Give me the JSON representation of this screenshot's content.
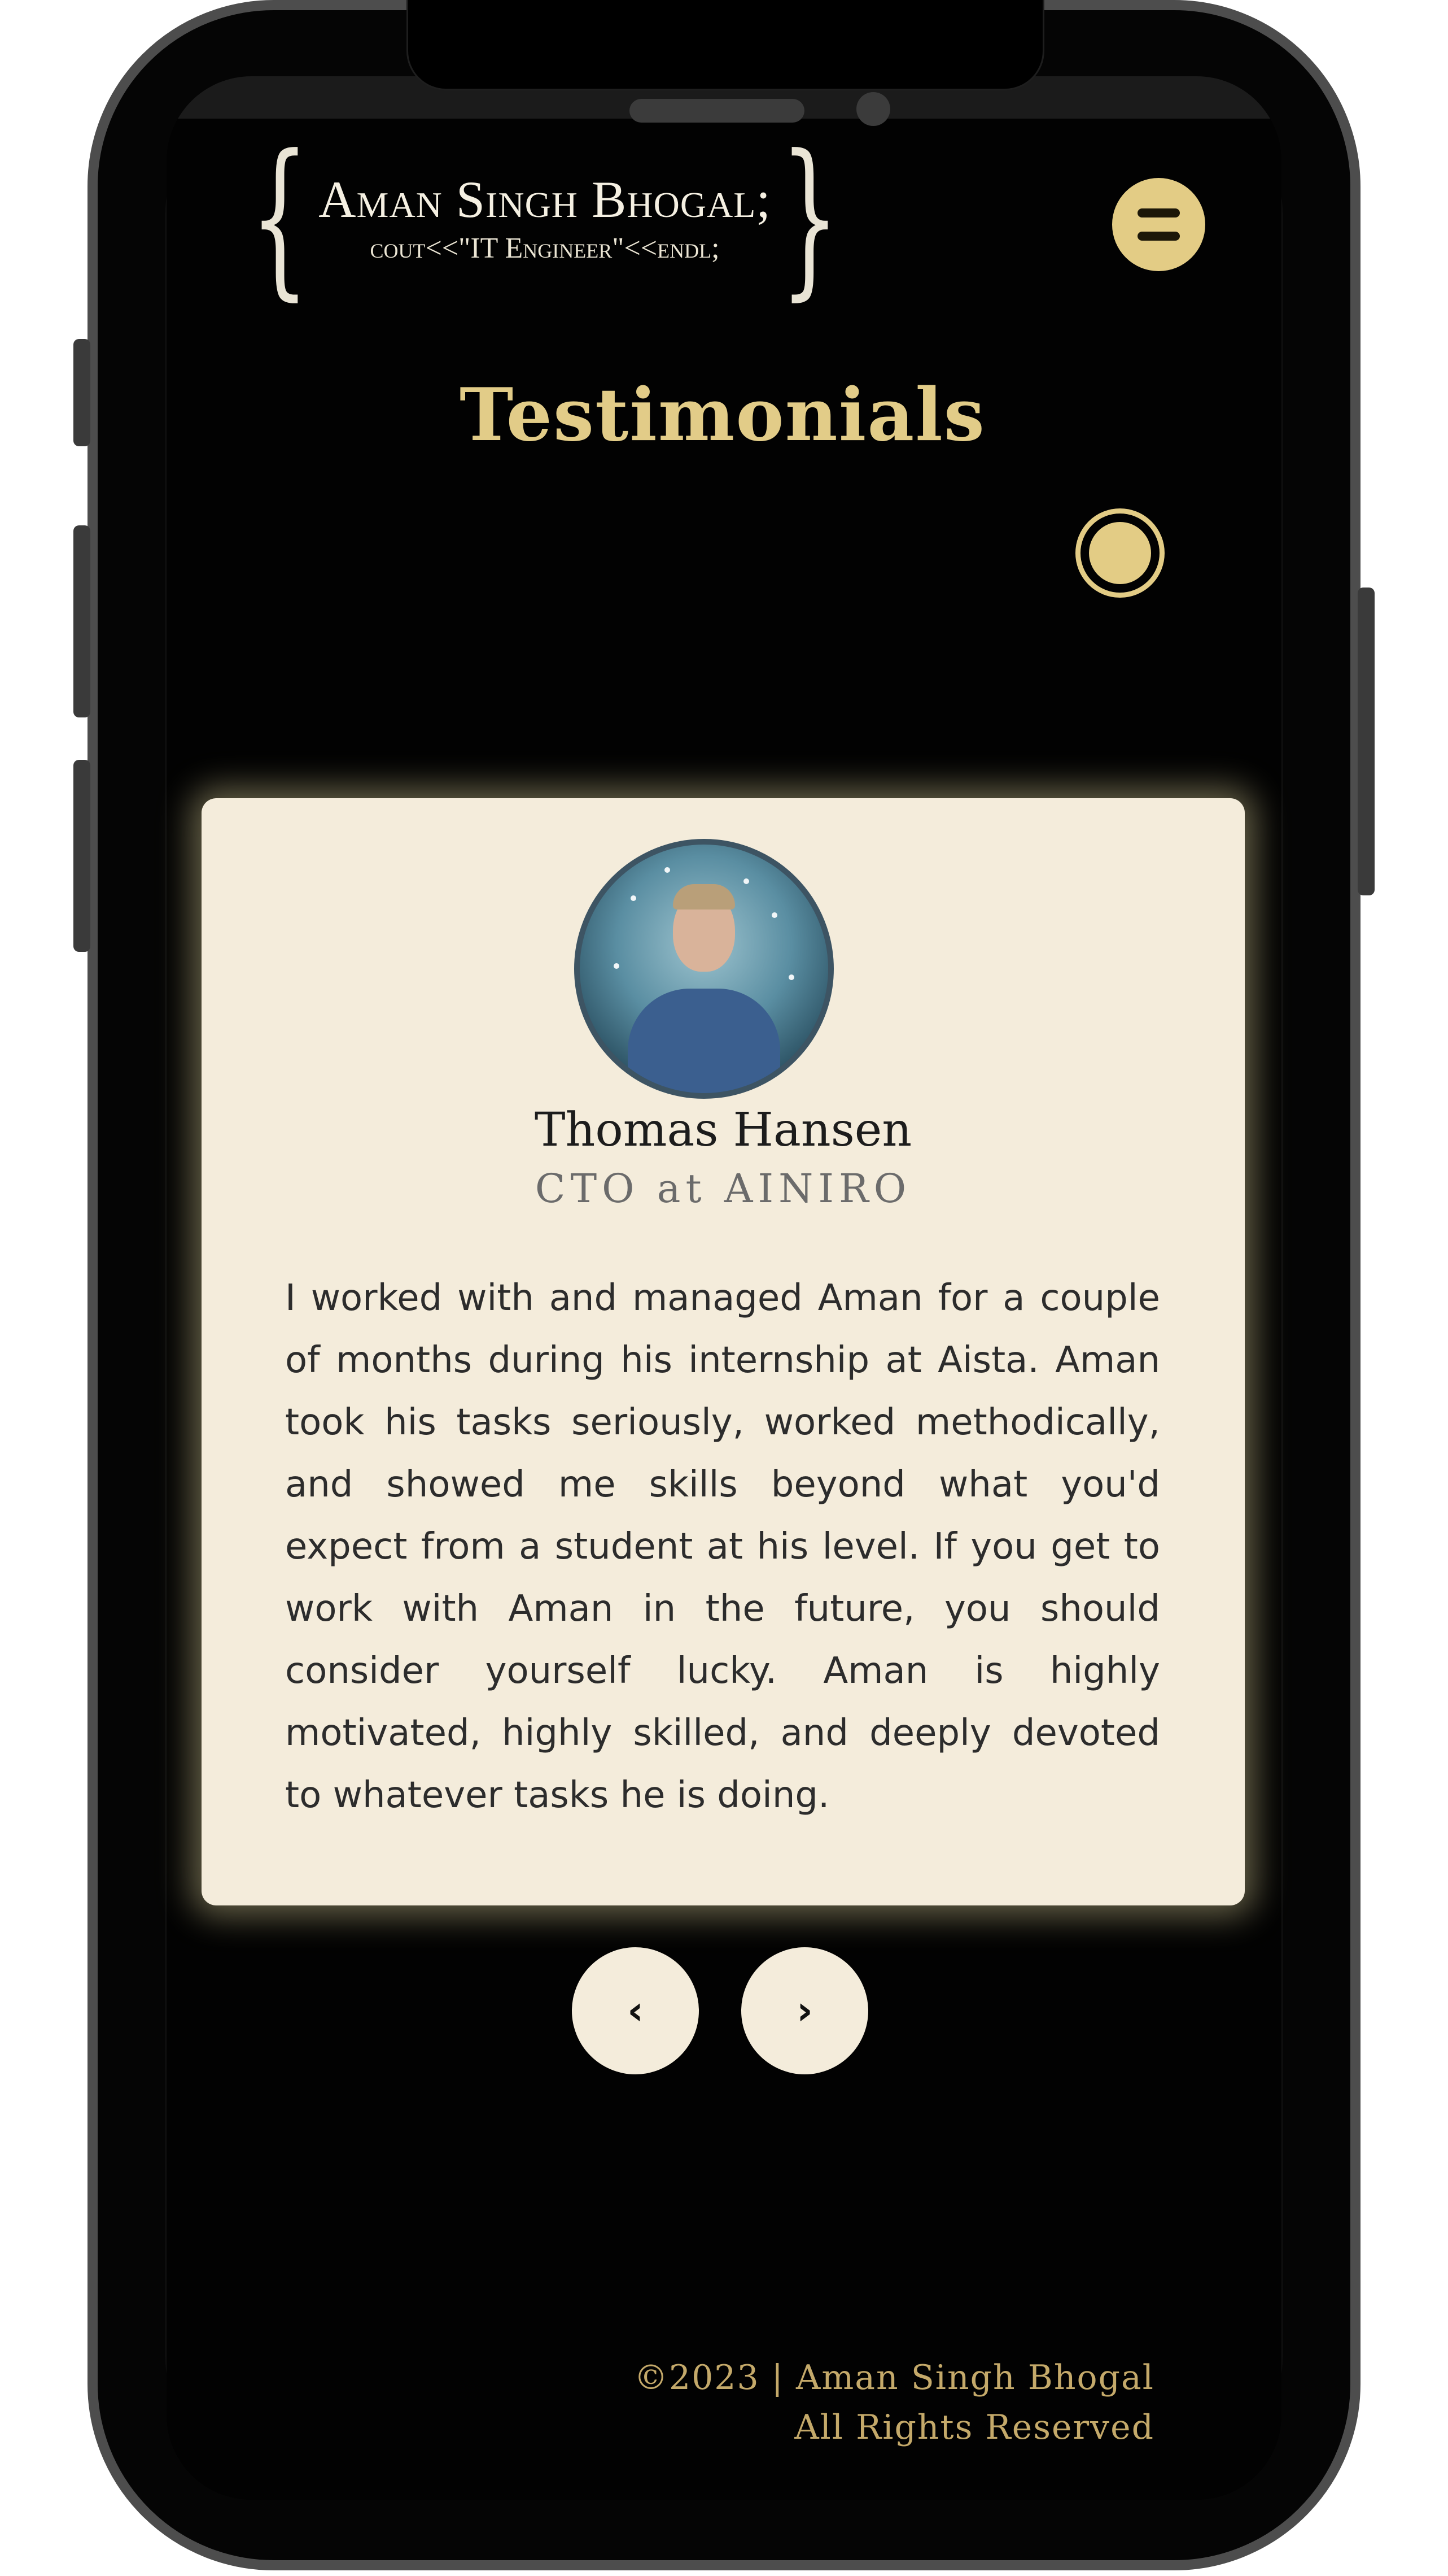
{
  "header": {
    "logo_name": "Aman Singh Bhogal;",
    "logo_subtitle": "cout<<\"IT Engineer\"<<endl;",
    "logo_brace_left": "{",
    "logo_brace_right": "}",
    "menu_icon": "hamburger-menu-icon"
  },
  "page": {
    "title": "Testimonials",
    "theme_toggle_icon": "theme-toggle-icon"
  },
  "testimonial": {
    "name": "Thomas Hansen",
    "role": "CTO at AINIRO",
    "text": "I worked with and managed Aman for a couple of months during his internship at Aista. Aman took his tasks seriously, worked methodically, and showed me skills beyond what you'd expect from a student at his level. If you get to work with Aman in the future, you should consider yourself lucky. Aman is highly motivated, highly skilled, and deeply devoted to whatever tasks he is doing."
  },
  "carousel": {
    "prev_label": "‹",
    "next_label": "›"
  },
  "footer": {
    "line1": "©2023 | Aman Singh Bhogal",
    "line2": "All Rights Reserved"
  },
  "colors": {
    "accent_gold": "#e3cc85",
    "card_background": "#f4ecdb",
    "page_background": "#020202"
  }
}
